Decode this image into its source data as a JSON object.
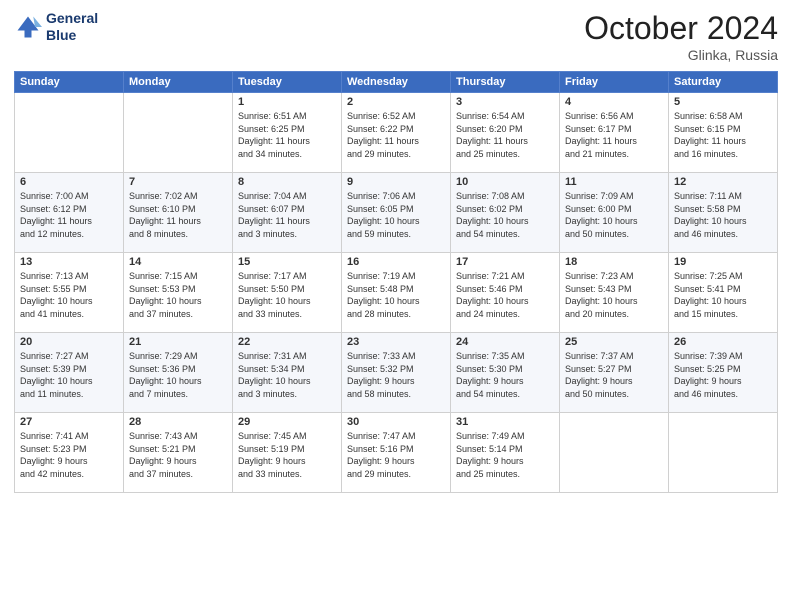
{
  "logo": {
    "line1": "General",
    "line2": "Blue"
  },
  "title": "October 2024",
  "location": "Glinka, Russia",
  "days_header": [
    "Sunday",
    "Monday",
    "Tuesday",
    "Wednesday",
    "Thursday",
    "Friday",
    "Saturday"
  ],
  "weeks": [
    [
      {
        "day": "",
        "text": ""
      },
      {
        "day": "",
        "text": ""
      },
      {
        "day": "1",
        "text": "Sunrise: 6:51 AM\nSunset: 6:25 PM\nDaylight: 11 hours\nand 34 minutes."
      },
      {
        "day": "2",
        "text": "Sunrise: 6:52 AM\nSunset: 6:22 PM\nDaylight: 11 hours\nand 29 minutes."
      },
      {
        "day": "3",
        "text": "Sunrise: 6:54 AM\nSunset: 6:20 PM\nDaylight: 11 hours\nand 25 minutes."
      },
      {
        "day": "4",
        "text": "Sunrise: 6:56 AM\nSunset: 6:17 PM\nDaylight: 11 hours\nand 21 minutes."
      },
      {
        "day": "5",
        "text": "Sunrise: 6:58 AM\nSunset: 6:15 PM\nDaylight: 11 hours\nand 16 minutes."
      }
    ],
    [
      {
        "day": "6",
        "text": "Sunrise: 7:00 AM\nSunset: 6:12 PM\nDaylight: 11 hours\nand 12 minutes."
      },
      {
        "day": "7",
        "text": "Sunrise: 7:02 AM\nSunset: 6:10 PM\nDaylight: 11 hours\nand 8 minutes."
      },
      {
        "day": "8",
        "text": "Sunrise: 7:04 AM\nSunset: 6:07 PM\nDaylight: 11 hours\nand 3 minutes."
      },
      {
        "day": "9",
        "text": "Sunrise: 7:06 AM\nSunset: 6:05 PM\nDaylight: 10 hours\nand 59 minutes."
      },
      {
        "day": "10",
        "text": "Sunrise: 7:08 AM\nSunset: 6:02 PM\nDaylight: 10 hours\nand 54 minutes."
      },
      {
        "day": "11",
        "text": "Sunrise: 7:09 AM\nSunset: 6:00 PM\nDaylight: 10 hours\nand 50 minutes."
      },
      {
        "day": "12",
        "text": "Sunrise: 7:11 AM\nSunset: 5:58 PM\nDaylight: 10 hours\nand 46 minutes."
      }
    ],
    [
      {
        "day": "13",
        "text": "Sunrise: 7:13 AM\nSunset: 5:55 PM\nDaylight: 10 hours\nand 41 minutes."
      },
      {
        "day": "14",
        "text": "Sunrise: 7:15 AM\nSunset: 5:53 PM\nDaylight: 10 hours\nand 37 minutes."
      },
      {
        "day": "15",
        "text": "Sunrise: 7:17 AM\nSunset: 5:50 PM\nDaylight: 10 hours\nand 33 minutes."
      },
      {
        "day": "16",
        "text": "Sunrise: 7:19 AM\nSunset: 5:48 PM\nDaylight: 10 hours\nand 28 minutes."
      },
      {
        "day": "17",
        "text": "Sunrise: 7:21 AM\nSunset: 5:46 PM\nDaylight: 10 hours\nand 24 minutes."
      },
      {
        "day": "18",
        "text": "Sunrise: 7:23 AM\nSunset: 5:43 PM\nDaylight: 10 hours\nand 20 minutes."
      },
      {
        "day": "19",
        "text": "Sunrise: 7:25 AM\nSunset: 5:41 PM\nDaylight: 10 hours\nand 15 minutes."
      }
    ],
    [
      {
        "day": "20",
        "text": "Sunrise: 7:27 AM\nSunset: 5:39 PM\nDaylight: 10 hours\nand 11 minutes."
      },
      {
        "day": "21",
        "text": "Sunrise: 7:29 AM\nSunset: 5:36 PM\nDaylight: 10 hours\nand 7 minutes."
      },
      {
        "day": "22",
        "text": "Sunrise: 7:31 AM\nSunset: 5:34 PM\nDaylight: 10 hours\nand 3 minutes."
      },
      {
        "day": "23",
        "text": "Sunrise: 7:33 AM\nSunset: 5:32 PM\nDaylight: 9 hours\nand 58 minutes."
      },
      {
        "day": "24",
        "text": "Sunrise: 7:35 AM\nSunset: 5:30 PM\nDaylight: 9 hours\nand 54 minutes."
      },
      {
        "day": "25",
        "text": "Sunrise: 7:37 AM\nSunset: 5:27 PM\nDaylight: 9 hours\nand 50 minutes."
      },
      {
        "day": "26",
        "text": "Sunrise: 7:39 AM\nSunset: 5:25 PM\nDaylight: 9 hours\nand 46 minutes."
      }
    ],
    [
      {
        "day": "27",
        "text": "Sunrise: 7:41 AM\nSunset: 5:23 PM\nDaylight: 9 hours\nand 42 minutes."
      },
      {
        "day": "28",
        "text": "Sunrise: 7:43 AM\nSunset: 5:21 PM\nDaylight: 9 hours\nand 37 minutes."
      },
      {
        "day": "29",
        "text": "Sunrise: 7:45 AM\nSunset: 5:19 PM\nDaylight: 9 hours\nand 33 minutes."
      },
      {
        "day": "30",
        "text": "Sunrise: 7:47 AM\nSunset: 5:16 PM\nDaylight: 9 hours\nand 29 minutes."
      },
      {
        "day": "31",
        "text": "Sunrise: 7:49 AM\nSunset: 5:14 PM\nDaylight: 9 hours\nand 25 minutes."
      },
      {
        "day": "",
        "text": ""
      },
      {
        "day": "",
        "text": ""
      }
    ]
  ]
}
